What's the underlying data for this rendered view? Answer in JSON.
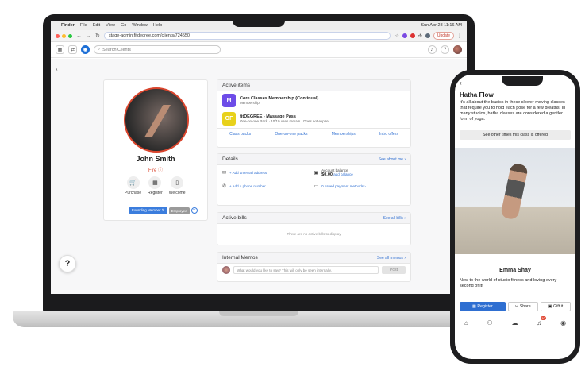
{
  "mac_menu": {
    "items": [
      "Finder",
      "File",
      "Edit",
      "View",
      "Go",
      "Window",
      "Help"
    ],
    "clock": "Sun Apr 28 11:16 AM"
  },
  "browser": {
    "url": "stage-admin.fitdegree.com/clients/724550",
    "update_label": "Update"
  },
  "app_header": {
    "search_placeholder": "Search Clients"
  },
  "profile": {
    "name": "John Smith",
    "rank": "Fire",
    "actions": [
      {
        "label": "Purchase",
        "icon": "cart-icon"
      },
      {
        "label": "Register",
        "icon": "calendar-icon"
      },
      {
        "label": "Welcome",
        "icon": "tablet-icon"
      }
    ],
    "tags": [
      "Founding Member",
      "Employee"
    ]
  },
  "active_items": {
    "title": "Active items",
    "items": [
      {
        "badge": "M",
        "badge_color": "#6d4ce8",
        "name": "Core Classes Membership (Continual)",
        "detail": "Membership"
      },
      {
        "badge": "OF",
        "badge_color": "#e8d11b",
        "name": "fitDEGREE - Massage Pass",
        "detail": "One-on-one Pack · 10/10 uses remain · Does not expire"
      }
    ],
    "tabs": [
      "Class packs",
      "One-on-one packs",
      "Memberships",
      "Intro offers"
    ]
  },
  "details": {
    "title": "Details",
    "link": "See about me",
    "add_email": "+ Add an email address",
    "add_phone": "+ Add a phone number",
    "balance_label": "Account balance",
    "balance_value": "$0.00",
    "balance_link": "add balance",
    "payment_methods": "0 saved payment methods"
  },
  "bills": {
    "title": "Active bills",
    "link": "See all bills",
    "empty": "There are no active bills to display"
  },
  "memos": {
    "title": "Internal Memos",
    "link": "See all memos",
    "placeholder": "What would you like to say? This will only be seen internally.",
    "post_label": "Post"
  },
  "help_label": "?",
  "phone": {
    "class_title": "Hatha Flow",
    "class_desc": "It's all about the basics in these slower moving classes that require you to hold each pose for a few breaths. In many studios, hatha classes are considered a gentler form of yoga.",
    "other_times": "See other times this class is offered",
    "instructor": "Emma Shay",
    "bio": "New to the world of studio fitness and loving every second of it!",
    "register": "Register",
    "share": "Share",
    "gift": "Gift it",
    "badge_count": "10"
  }
}
